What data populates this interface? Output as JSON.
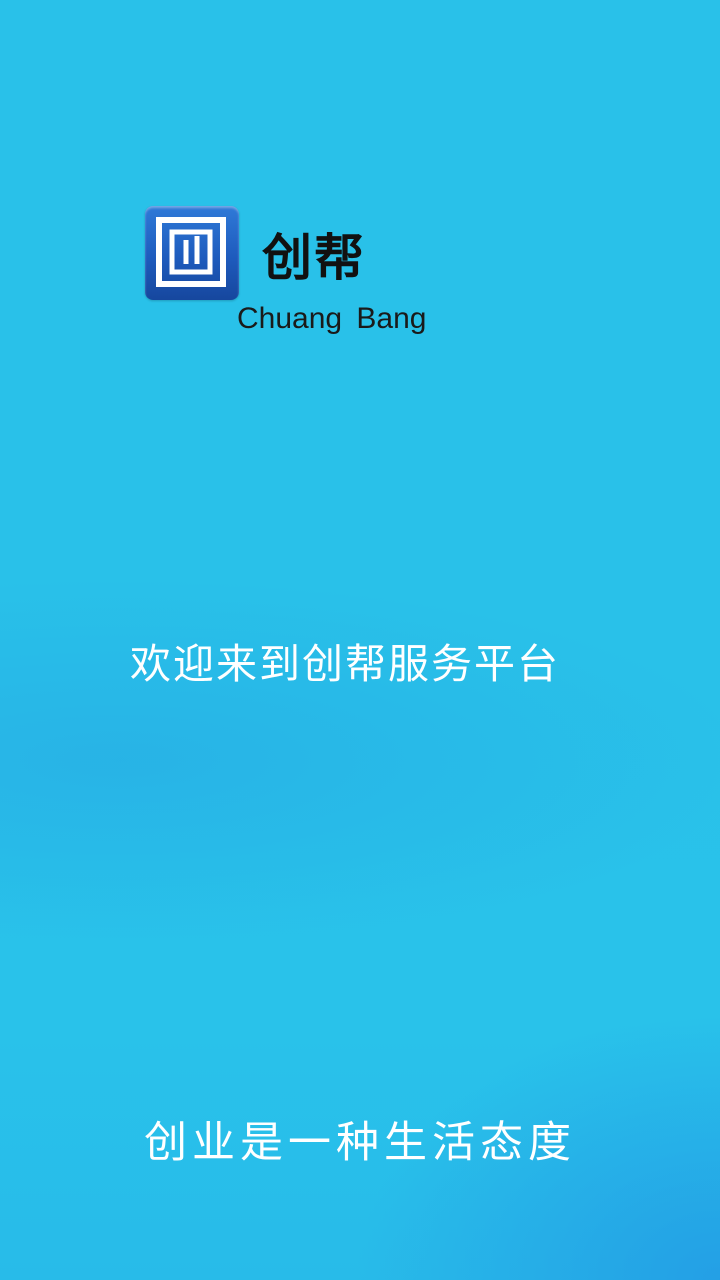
{
  "logo": {
    "icon": "chuangbang-logo-icon",
    "name_cn": "创帮",
    "name_en": "Chuang  Bang",
    "colors": {
      "icon_blue": "#1e5bbd",
      "text": "#111111"
    }
  },
  "welcome_text": "欢迎来到创帮服务平台",
  "slogan_text": "创业是一种生活态度",
  "colors": {
    "background": "#29c1e9",
    "text_light": "#ffffff"
  }
}
